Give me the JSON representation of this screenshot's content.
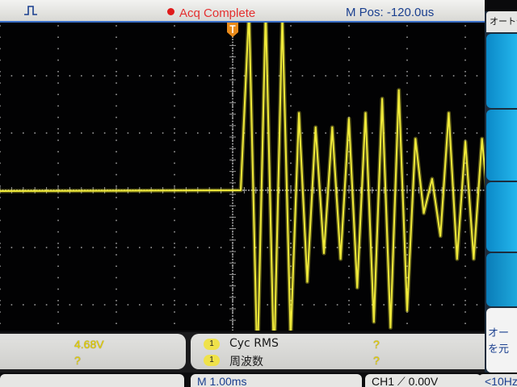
{
  "status": {
    "acq_state": "Acq Complete",
    "horizontal_position": "M Pos: -120.0us"
  },
  "menu": {
    "title": "オートセ",
    "bottom_key_line1": "オー",
    "bottom_key_line2": "を元"
  },
  "measurements": {
    "left_value_1": "4.68V",
    "left_value_2": "?",
    "items": [
      {
        "channel": "1",
        "label": "Cyc RMS",
        "value": "?"
      },
      {
        "channel": "1",
        "label": "周波数",
        "value": "?"
      }
    ]
  },
  "bottom_bar": {
    "timebase": "M 1.00ms",
    "trigger": "CH1 ⟋ 0.00V",
    "extra": "<10Hz"
  },
  "colors": {
    "trace": "#f0ea3a",
    "graticule": "#9a9a9a",
    "softkey": "#1aa6e0",
    "trigger_marker": "#e88a1a"
  },
  "trace": {
    "pre_trigger_level_div": 0.0,
    "peaks_div": [
      3.15,
      -3.1,
      3.15,
      -3.05,
      3.05,
      -2.6,
      1.35,
      -1.6,
      1.1,
      -1.1,
      1.1,
      -1.2,
      1.25,
      -1.7,
      1.35,
      -2.3,
      1.6,
      -2.4,
      1.75,
      -2.1,
      0.9,
      -0.4,
      0.2,
      -0.8,
      1.35,
      -1.2,
      0.85,
      -1.2,
      0.9,
      -0.7
    ]
  }
}
